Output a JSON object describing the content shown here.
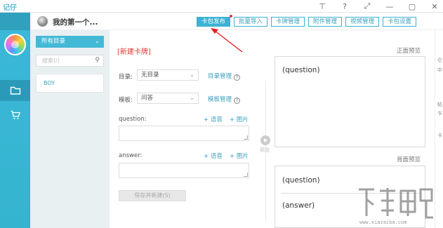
{
  "app": {
    "logo": "记仔"
  },
  "window_controls": {
    "pin": "⊤",
    "help": "?",
    "expand": "⤢",
    "minimize": "—",
    "maximize": "▢",
    "close": "✕"
  },
  "header": {
    "username": "我的第一个...",
    "buttons": [
      "卡包发布",
      "批量导入",
      "卡牌管理",
      "附件管理",
      "视频管理",
      "卡包设置"
    ]
  },
  "directory": {
    "selected": "所有目录",
    "search_placeholder": "搜索(/)",
    "items": [
      "BOY"
    ]
  },
  "form": {
    "title": "[新建卡牌]",
    "directory_label": "目录:",
    "directory_value": "无目录",
    "directory_link": "目录管理",
    "template_label": "模板:",
    "template_value": "问答",
    "template_link": "模板管理",
    "question_label": "question:",
    "answer_label": "answer:",
    "add_voice": "+ 语音",
    "add_image": "+ 图片",
    "save_button": "保存并新建(S)"
  },
  "splitter": {
    "label": "预览"
  },
  "preview": {
    "front_label": "正面预览",
    "back_label": "背面预览",
    "front_text": "(question)",
    "back_question": "(question)",
    "back_answer": "(answer)"
  },
  "gutter": [
    "仑",
    "中",
    "帖",
    "乍",
    "卡"
  ],
  "watermark": {
    "text": "www.xiazaiba.com"
  },
  "colors": {
    "accent": "#3bb3d3",
    "alert": "#e33333",
    "rail": "#3bb8d8"
  }
}
